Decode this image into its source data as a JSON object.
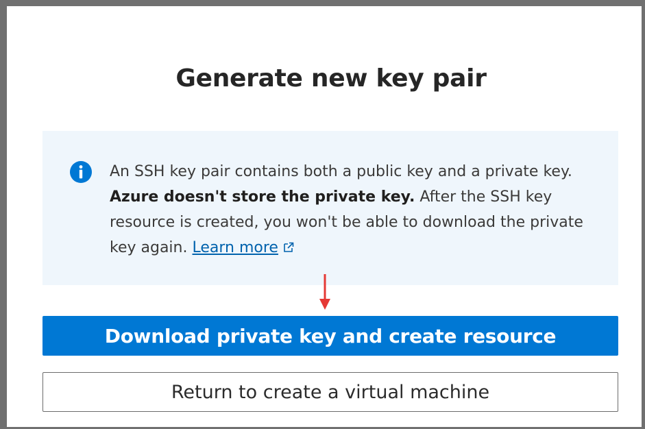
{
  "dialog": {
    "title": "Generate new key pair"
  },
  "info": {
    "icon": "info-icon",
    "text_part1": "An SSH key pair contains both a public key and a private key. ",
    "text_bold": "Azure doesn't store the private key.",
    "text_part2": " After the SSH key resource is created, you won't be able to download the private key again. ",
    "learn_more_label": "Learn more",
    "learn_more_icon": "external-link-icon"
  },
  "actions": {
    "primary_label": "Download private key and create resource",
    "secondary_label": "Return to create a virtual machine"
  },
  "annotation": {
    "arrow_icon": "red-down-arrow",
    "arrow_color": "#e53935"
  },
  "colors": {
    "accent": "#0078d4",
    "info_background": "#eff6fc",
    "info_icon": "#0078d4",
    "link": "#0062ad"
  }
}
